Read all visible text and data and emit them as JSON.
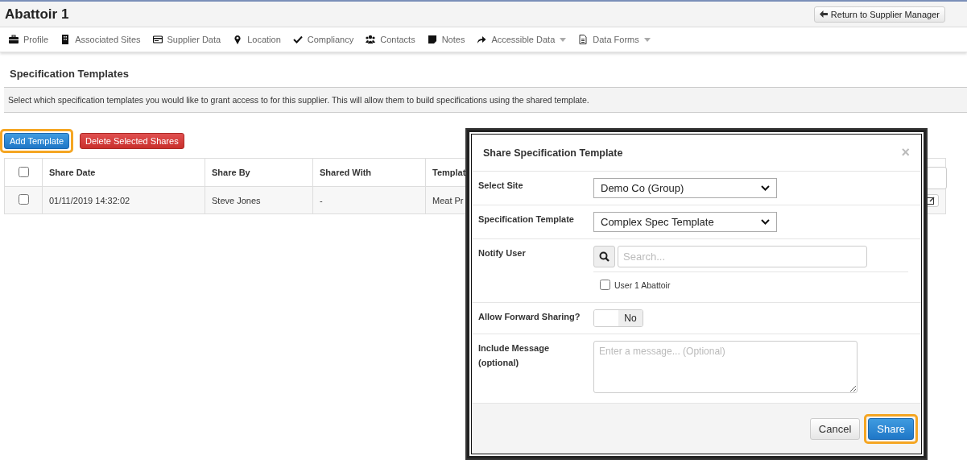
{
  "page": {
    "title": "Abattoir 1",
    "return_button": "Return to Supplier Manager"
  },
  "nav": [
    {
      "label": "Profile",
      "dropdown": false
    },
    {
      "label": "Associated Sites",
      "dropdown": false
    },
    {
      "label": "Supplier Data",
      "dropdown": false
    },
    {
      "label": "Location",
      "dropdown": false
    },
    {
      "label": "Compliancy",
      "dropdown": false
    },
    {
      "label": "Contacts",
      "dropdown": false
    },
    {
      "label": "Notes",
      "dropdown": false
    },
    {
      "label": "Accessible Data",
      "dropdown": true
    },
    {
      "label": "Data Forms",
      "dropdown": true
    }
  ],
  "section": {
    "title": "Specification Templates",
    "description": "Select which specification templates you would like to grant access to for this supplier. This will allow them to build specifications using the shared template."
  },
  "actions": [
    {
      "label": "Add Template",
      "kind": "primary",
      "highlighted": true
    },
    {
      "label": "Delete Selected Shares",
      "kind": "danger",
      "highlighted": false
    }
  ],
  "table": {
    "header_checked": false,
    "columns": [
      "Share Date",
      "Share By",
      "Shared With",
      "Templat"
    ],
    "rows": [
      {
        "checked": false,
        "cells": [
          "01/11/2019 14:32:02",
          "Steve Jones",
          "-",
          "Meat Pr"
        ]
      }
    ]
  },
  "modal": {
    "title": "Share Specification Template",
    "close": "×",
    "fields": [
      {
        "kind": "select",
        "label": "Select Site",
        "value": "Demo Co (Group)"
      },
      {
        "kind": "select",
        "label": "Specification Template",
        "value": "Complex Spec Template"
      },
      {
        "kind": "user_search",
        "label": "Notify User",
        "placeholder": "Search...",
        "users": [
          {
            "name": "User 1 Abattoir",
            "checked": false
          }
        ]
      },
      {
        "kind": "toggle",
        "label": "Allow Forward Sharing?",
        "on": false,
        "off_label": "No"
      },
      {
        "kind": "textarea",
        "label": "Include Message (optional)",
        "placeholder": "Enter a message... (Optional)"
      }
    ],
    "buttons": [
      {
        "label": "Cancel",
        "kind": "default",
        "highlighted": false
      },
      {
        "label": "Share",
        "kind": "primary",
        "highlighted": true
      }
    ]
  }
}
